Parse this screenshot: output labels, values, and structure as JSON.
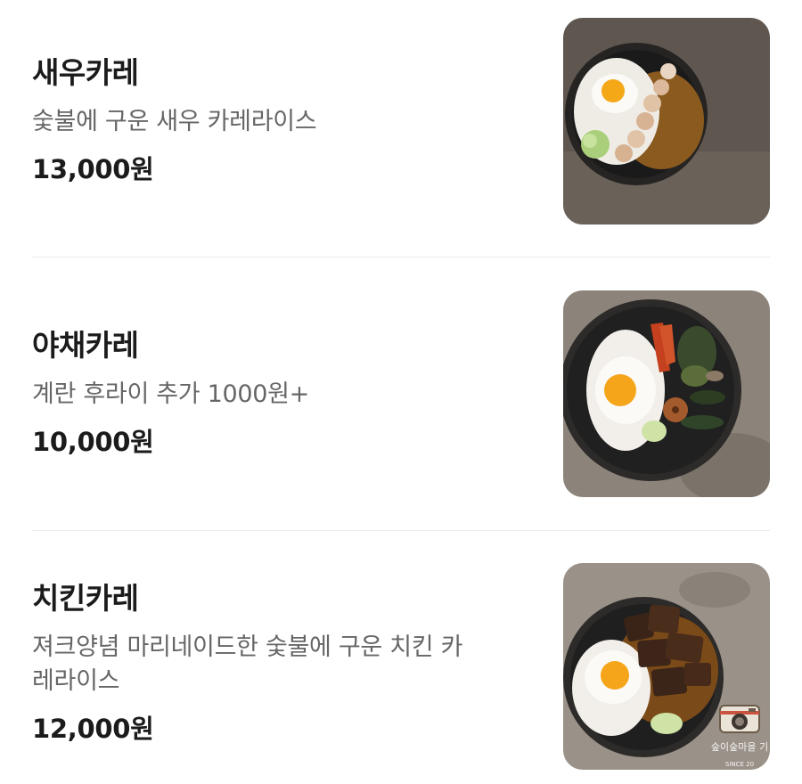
{
  "menu": [
    {
      "name": "새우카레",
      "description": "숯불에 구운 새우 카레라이스",
      "price": "13,000원"
    },
    {
      "name": "야채카레",
      "description": "계란 후라이 추가 1000원+",
      "price": "10,000원"
    },
    {
      "name": "치킨카레",
      "description_line1": "져크양념 마리네이드한 숯불에 구운 치킨 카",
      "description_line2": "레라이스",
      "price": "12,000원"
    }
  ],
  "watermark": {
    "text": "숲이숲마을 기",
    "since": "SINCE 20"
  },
  "colors": {
    "text_primary": "#1b1b1b",
    "text_secondary": "#666666",
    "divider": "#ececec"
  }
}
